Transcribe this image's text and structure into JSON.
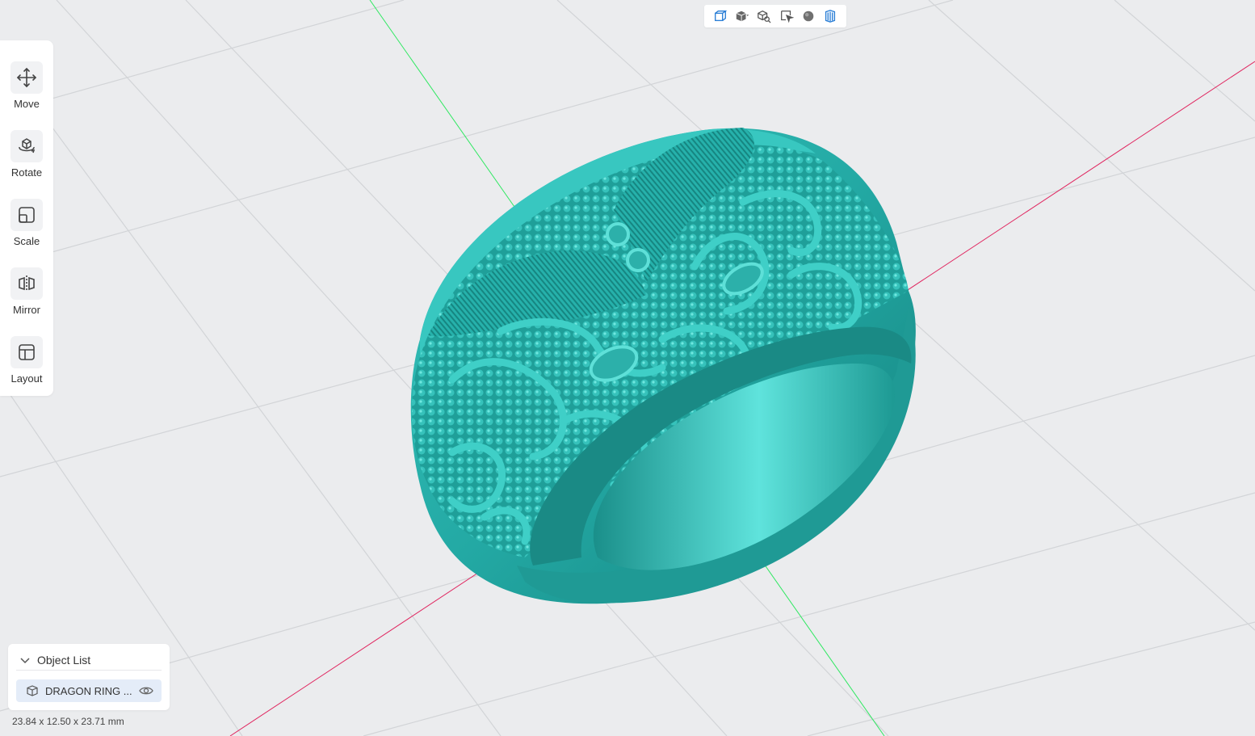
{
  "view_toolbar": {
    "buttons": [
      {
        "name": "view-cube-icon"
      },
      {
        "name": "shaded-cube-dropdown-icon"
      },
      {
        "name": "zoom-fit-icon"
      },
      {
        "name": "select-region-icon"
      },
      {
        "name": "sphere-material-icon"
      },
      {
        "name": "section-view-icon"
      }
    ]
  },
  "tools": [
    {
      "label": "Move",
      "icon": "move-icon"
    },
    {
      "label": "Rotate",
      "icon": "rotate-icon"
    },
    {
      "label": "Scale",
      "icon": "scale-icon"
    },
    {
      "label": "Mirror",
      "icon": "mirror-icon"
    },
    {
      "label": "Layout",
      "icon": "layout-icon"
    }
  ],
  "object_list": {
    "title": "Object List",
    "items": [
      {
        "name": "DRAGON RING ..."
      }
    ]
  },
  "dimensions": "23.84 x 12.50 x 23.71 mm",
  "colors": {
    "background": "#ebecee",
    "model": "#2fb5b0",
    "x_axis": "#e0245e",
    "y_axis": "#2ee860",
    "accent": "#2b7fd6"
  }
}
